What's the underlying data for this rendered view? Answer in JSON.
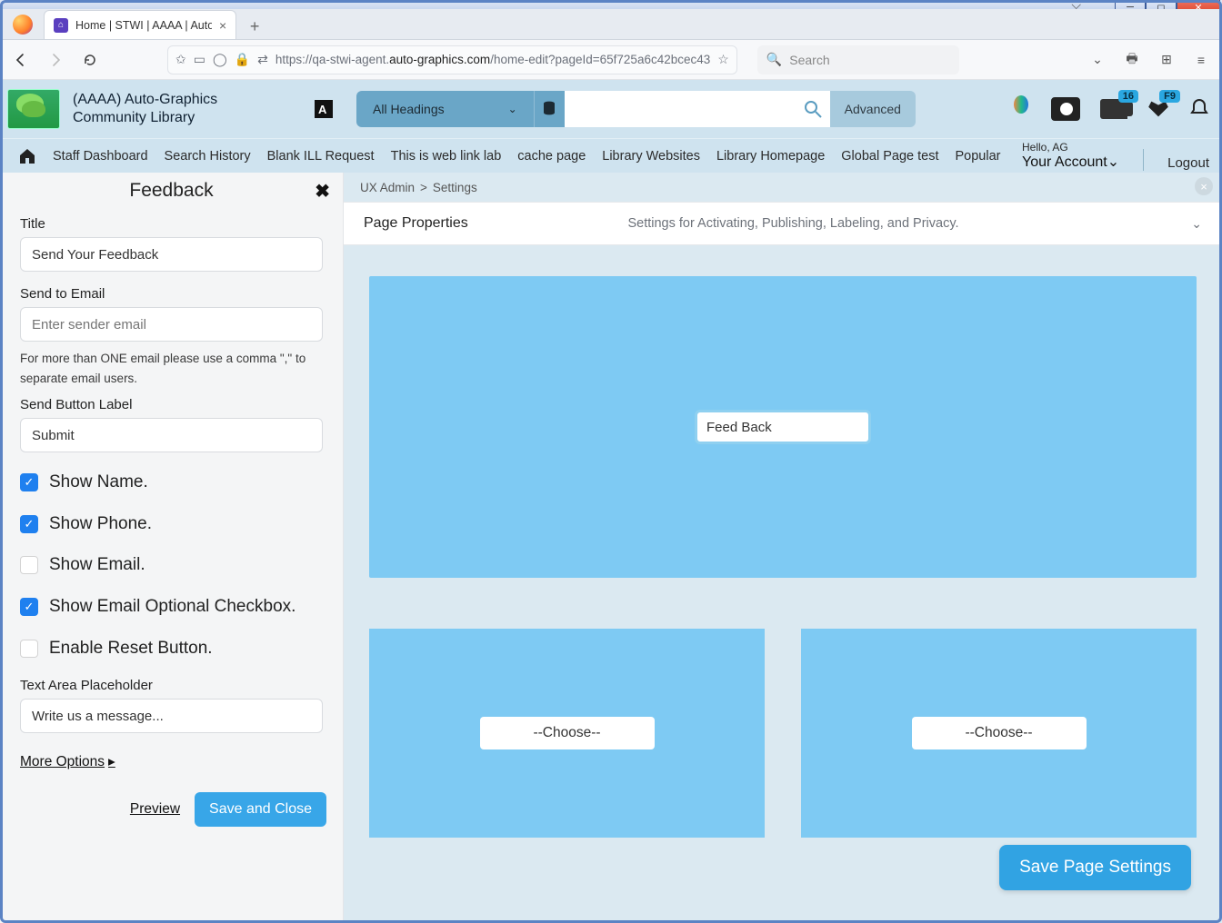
{
  "browser": {
    "tab_title": "Home | STWI | AAAA | Auto-Gr",
    "url_prefix": "https://qa-stwi-agent.",
    "url_domain": "auto-graphics.com",
    "url_path": "/home-edit?pageId=65f725a6c42bcec43",
    "search_placeholder": "Search"
  },
  "header": {
    "library_name": "(AAAA) Auto-Graphics Community Library",
    "heading_select": "All Headings",
    "advanced": "Advanced",
    "badge_news": "16",
    "badge_heart": "F9"
  },
  "nav": {
    "items": [
      "Staff Dashboard",
      "Search History",
      "Blank ILL Request",
      "This is web link lab",
      "cache page",
      "Library Websites",
      "Library Homepage",
      "Global Page test",
      "Popular"
    ],
    "hello": "Hello, AG",
    "account": "Your Account",
    "logout": "Logout"
  },
  "side": {
    "panel_title": "Feedback",
    "title_label": "Title",
    "title_value": "Send Your Feedback",
    "email_label": "Send to Email",
    "email_placeholder": "Enter sender email",
    "email_hint": "For more than ONE email please use a comma \",\" to separate email users.",
    "btn_label_label": "Send Button Label",
    "btn_label_value": "Submit",
    "chk_name": "Show Name.",
    "chk_phone": "Show Phone.",
    "chk_email": "Show Email.",
    "chk_optemail": "Show Email Optional Checkbox.",
    "chk_reset": "Enable Reset Button.",
    "ta_label": "Text Area Placeholder",
    "ta_value": "Write us a message...",
    "more": "More Options",
    "preview": "Preview",
    "save": "Save and Close"
  },
  "content": {
    "crumb1": "UX Admin",
    "crumb2": "Settings",
    "prop_title": "Page Properties",
    "prop_sub": "Settings for Activating, Publishing, Labeling, and Privacy.",
    "big_input": "Feed Back",
    "choose": "--Choose--",
    "savepage": "Save Page Settings"
  }
}
